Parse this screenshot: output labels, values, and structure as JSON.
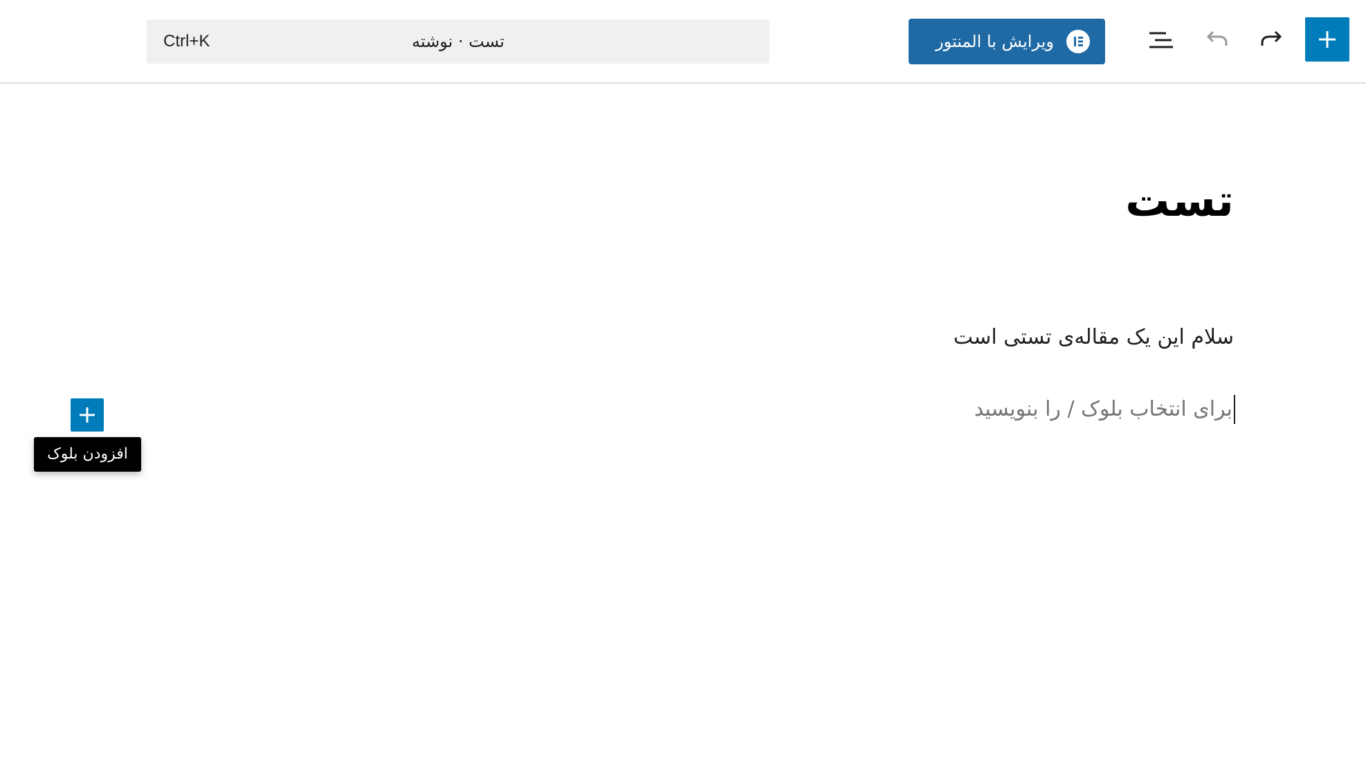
{
  "toolbar": {
    "inserter_icon": "plus-icon",
    "redo_icon": "redo-icon",
    "undo_icon": "undo-icon",
    "list_view_icon": "list-view-icon",
    "elementor_button": {
      "label": "ویرایش با المنتور",
      "icon": "elementor-icon"
    },
    "command_bar": {
      "title": "تست · نوشته",
      "shortcut": "Ctrl+K"
    }
  },
  "editor": {
    "post_title": "تست",
    "paragraph": "سلام این یک مقاله‌ی تستی است",
    "empty_block_placeholder": "برای انتخاب بلوک / را بنویسید",
    "appender_icon": "plus-icon",
    "appender_tooltip": "افزودن بلوک"
  },
  "colors": {
    "accent": "#007cba",
    "elementor_button": "#1f6aa5",
    "toolbar_border": "#dcdcdc",
    "placeholder_text": "#757575",
    "tooltip_bg": "#000000"
  }
}
